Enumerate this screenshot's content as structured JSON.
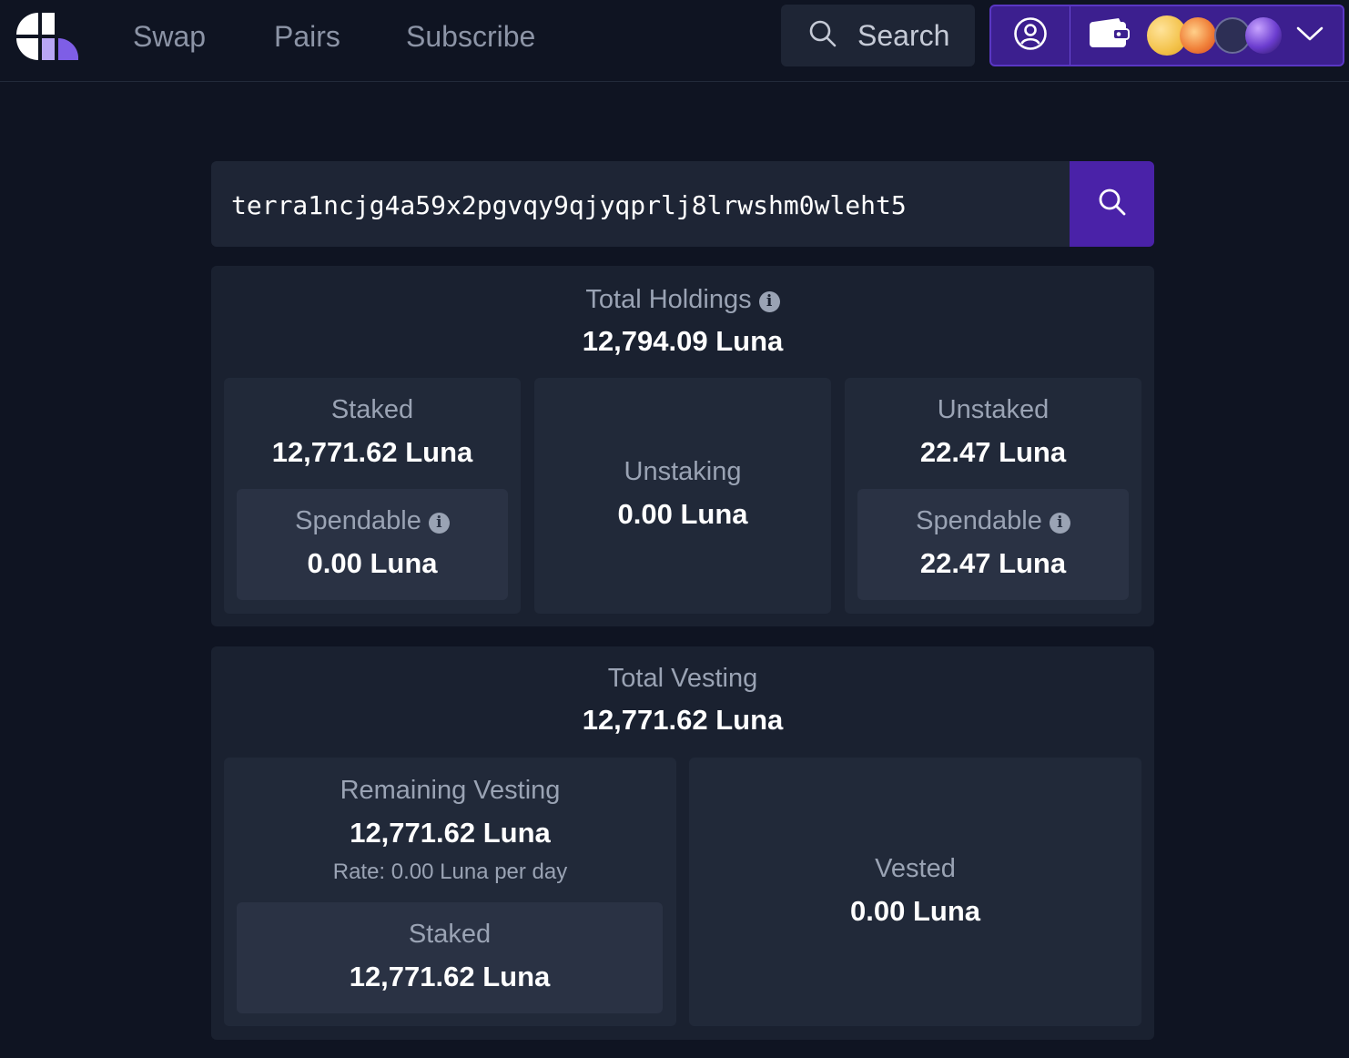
{
  "nav": {
    "links": [
      "Swap",
      "Pairs",
      "Subscribe"
    ],
    "search_label": "Search"
  },
  "colors": {
    "background": "#0f1422",
    "accent": "#4a22a8",
    "panel": "#1a2130"
  },
  "address": {
    "value": "terra1ncjg4a59x2pgvqy9qjyqprlj8lrwshm0wleht5"
  },
  "holdings": {
    "title": "Total Holdings",
    "total": "12,794.09 Luna",
    "staked": {
      "label": "Staked",
      "value": "12,771.62 Luna",
      "spendable_label": "Spendable",
      "spendable_value": "0.00 Luna"
    },
    "unstaking": {
      "label": "Unstaking",
      "value": "0.00 Luna"
    },
    "unstaked": {
      "label": "Unstaked",
      "value": "22.47 Luna",
      "spendable_label": "Spendable",
      "spendable_value": "22.47 Luna"
    }
  },
  "vesting": {
    "title": "Total Vesting",
    "total": "12,771.62 Luna",
    "remaining": {
      "label": "Remaining Vesting",
      "value": "12,771.62 Luna",
      "rate": "Rate: 0.00 Luna per day",
      "staked_label": "Staked",
      "staked_value": "12,771.62 Luna"
    },
    "vested": {
      "label": "Vested",
      "value": "0.00 Luna"
    }
  }
}
